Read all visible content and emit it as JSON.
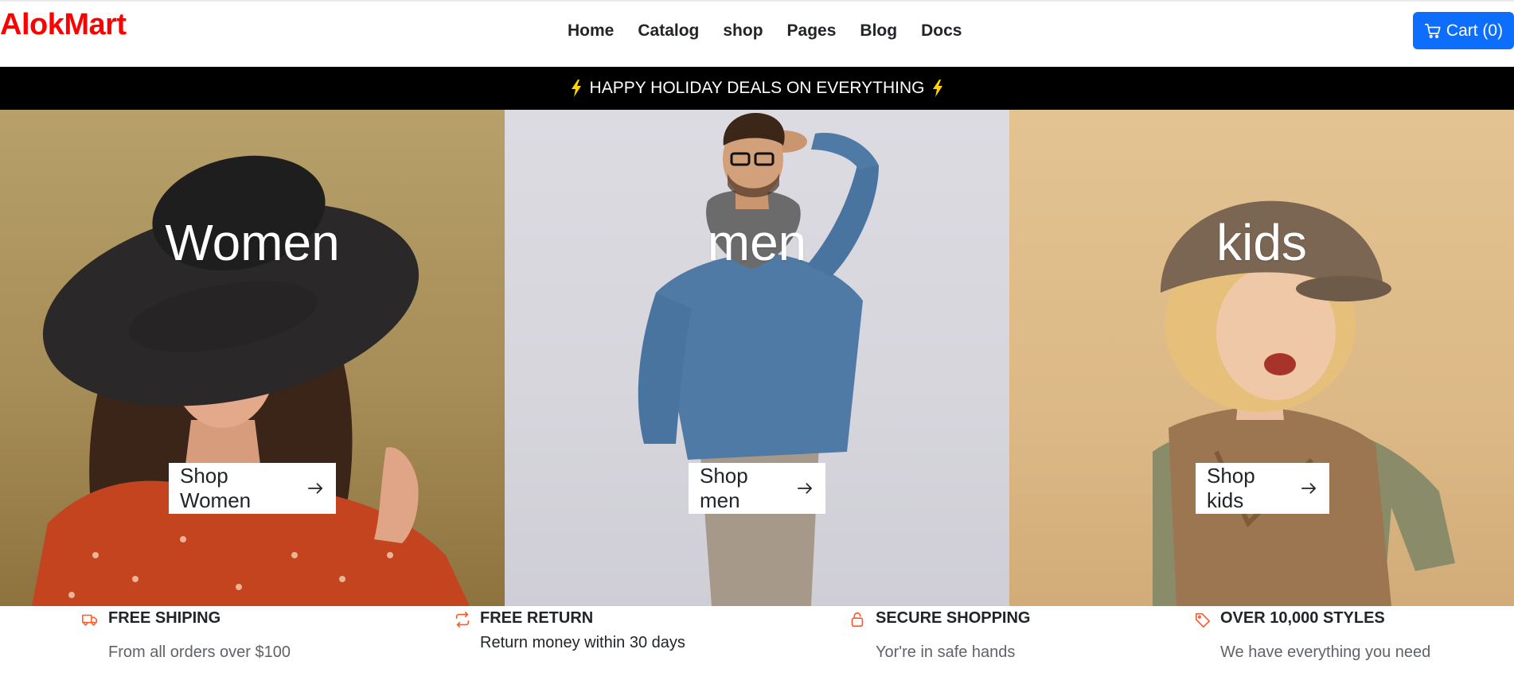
{
  "brand": {
    "name": "AlokMart",
    "color": "#ff0000"
  },
  "nav": {
    "items": [
      "Home",
      "Catalog",
      "shop",
      "Pages",
      "Blog",
      "Docs"
    ]
  },
  "cart": {
    "label": "Cart (0)",
    "icon": "cart-icon",
    "color": "#0d6efd"
  },
  "promo": {
    "text": "HAPPY HOLIDAY DEALS ON EVERYTHING",
    "icon": "lightning-icon",
    "icon_color": "#ffd400"
  },
  "categories": [
    {
      "title": "Women",
      "button": "Shop Women"
    },
    {
      "title": "men",
      "button": "Shop men"
    },
    {
      "title": "kids",
      "button": "Shop kids"
    }
  ],
  "features": [
    {
      "icon": "truck-icon",
      "title": "FREE SHIPING",
      "text": "From all orders over $100"
    },
    {
      "icon": "return-icon",
      "title": "FREE RETURN",
      "text": "Return money within 30 days"
    },
    {
      "icon": "lock-icon",
      "title": "SECURE SHOPPING",
      "text": "Yor're in safe hands"
    },
    {
      "icon": "tag-icon",
      "title": "OVER 10,000 STYLES",
      "text": "We have everything you need"
    }
  ],
  "accent_color": "#fd5a2a"
}
